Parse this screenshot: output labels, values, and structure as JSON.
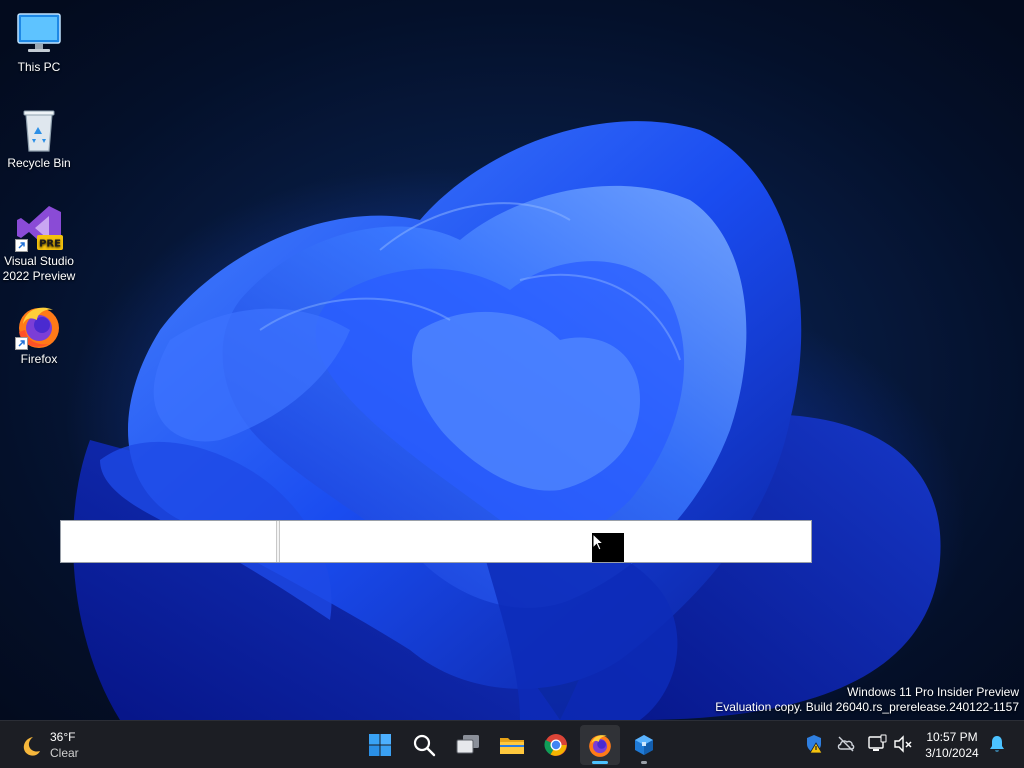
{
  "desktop": {
    "icons": [
      {
        "label": "This PC",
        "icon": "computer-icon"
      },
      {
        "label": "Recycle Bin",
        "icon": "recycle-bin-icon"
      },
      {
        "label": "Visual Studio\n2022 Preview",
        "line1": "Visual Studio",
        "line2": "2022 Preview",
        "icon": "visual-studio-icon",
        "badge": "PRE"
      },
      {
        "label": "Firefox",
        "icon": "firefox-icon"
      }
    ],
    "watermark": {
      "line1": "Windows 11 Pro Insider Preview",
      "line2": "Evaluation copy. Build 26040.rs_prerelease.240122-1157"
    }
  },
  "taskbar": {
    "weather": {
      "temp": "36°F",
      "condition": "Clear",
      "icon": "moon-icon"
    },
    "apps": [
      {
        "name": "start",
        "icon": "windows-start-icon"
      },
      {
        "name": "search",
        "icon": "search-icon"
      },
      {
        "name": "task-view",
        "icon": "task-view-icon"
      },
      {
        "name": "file-explorer",
        "icon": "folder-icon"
      },
      {
        "name": "chrome",
        "icon": "chrome-icon"
      },
      {
        "name": "firefox",
        "icon": "firefox-icon",
        "active": true
      },
      {
        "name": "app",
        "icon": "cube-app-icon"
      }
    ],
    "tray": [
      "security-warning-icon",
      "cloud-offline-icon",
      "network-icon",
      "volume-muted-icon"
    ],
    "clock": {
      "time": "10:57 PM",
      "date": "3/10/2024"
    },
    "notifications_icon": "bell-icon"
  },
  "colors": {
    "accent": "#2f6bff",
    "taskbar_bg": "#1c1e24",
    "active_indicator": "#4cc2ff"
  }
}
